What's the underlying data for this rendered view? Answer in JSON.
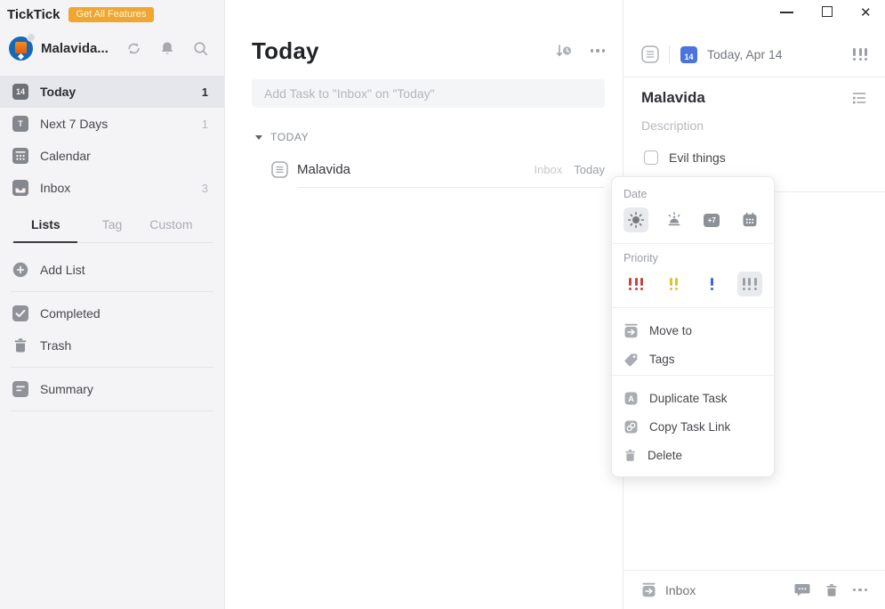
{
  "window": {
    "close_glyph": "✕"
  },
  "brand": {
    "logo": "TickTick",
    "upgrade_button": "Get All Features"
  },
  "sidebar": {
    "account": {
      "name": "Malavida..."
    },
    "nav": [
      {
        "label": "Today",
        "count": "1",
        "icon_label": "14"
      },
      {
        "label": "Next 7 Days",
        "count": "1",
        "icon_label": "T"
      },
      {
        "label": "Calendar",
        "count": ""
      },
      {
        "label": "Inbox",
        "count": "3"
      }
    ],
    "tabs": [
      {
        "label": "Lists"
      },
      {
        "label": "Tag"
      },
      {
        "label": "Custom"
      }
    ],
    "add_list_label": "Add List",
    "completed_label": "Completed",
    "trash_label": "Trash",
    "summary_label": "Summary"
  },
  "main": {
    "title": "Today",
    "add_task_placeholder": "Add Task to \"Inbox\" on \"Today\"",
    "group_label": "TODAY",
    "task": {
      "title": "Malavida",
      "list": "Inbox",
      "date": "Today"
    }
  },
  "detail": {
    "date": "Today, Apr 14",
    "cal_day": "14",
    "title": "Malavida",
    "description_placeholder": "Description",
    "subtask": {
      "label": "Evil things",
      "checked": false
    },
    "footer_list": "Inbox"
  },
  "menu": {
    "date_label": "Date",
    "priority_label": "Priority",
    "plus7_label": "+7",
    "duplicate_letter": "A",
    "items": [
      {
        "label": "Move to"
      },
      {
        "label": "Tags"
      },
      {
        "label": "Duplicate Task"
      },
      {
        "label": "Copy Task Link"
      },
      {
        "label": "Delete"
      }
    ]
  },
  "colors": {
    "brand_orange": "#f0a732",
    "accent_blue": "#4a73dd",
    "priority_high": "#c8443c",
    "priority_medium": "#ddc233",
    "priority_low": "#3f63cf",
    "icon_gray": "#9ba0a6",
    "sidebar_bg": "#f4f4f6",
    "selected_row_bg": "#e5e7ed"
  }
}
